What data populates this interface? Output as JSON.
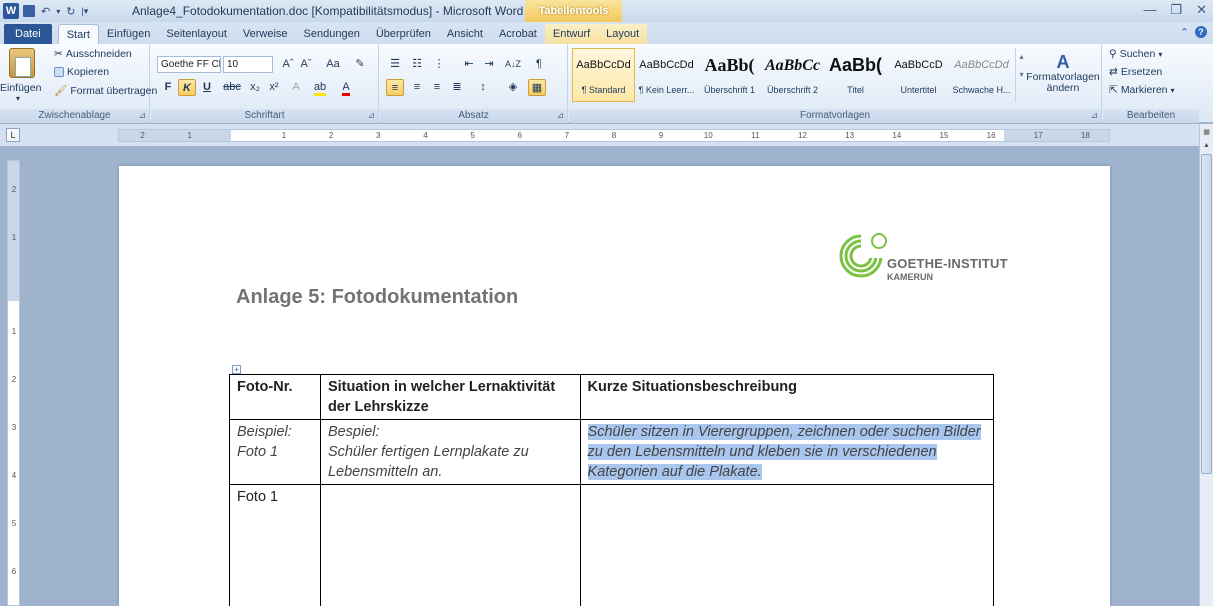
{
  "window": {
    "app_icon": "W",
    "title": "Anlage4_Fotodokumentation.doc [Kompatibilitätsmodus] - Microsoft Word",
    "contextual_tab_group": "Tabellentools"
  },
  "tabs": [
    "Datei",
    "Start",
    "Einfügen",
    "Seitenlayout",
    "Verweise",
    "Sendungen",
    "Überprüfen",
    "Ansicht",
    "Acrobat",
    "Entwurf",
    "Layout"
  ],
  "clipboard": {
    "paste": "Einfügen",
    "cut": "Ausschneiden",
    "copy": "Kopieren",
    "format_painter": "Format übertragen",
    "label": "Zwischenablage"
  },
  "font": {
    "name": "Goethe FF Cl",
    "size": "10",
    "grow": "Aˆ",
    "shrink": "Aˇ",
    "case": "Aa",
    "bold": "F",
    "italic": "K",
    "underline": "U",
    "strike": "abc",
    "subscript": "x₂",
    "superscript": "x²",
    "label": "Schriftart"
  },
  "paragraph": {
    "label": "Absatz",
    "pilcrow": "¶",
    "sort": "A↓Z"
  },
  "styles": {
    "label": "Formatvorlagen",
    "items": [
      {
        "sample": "AaBbCcDd",
        "name": "¶ Standard"
      },
      {
        "sample": "AaBbCcDd",
        "name": "¶ Kein Leerr..."
      },
      {
        "sample": "AaBb(",
        "name": "Überschrift 1"
      },
      {
        "sample": "AaBbCc",
        "name": "Überschrift 2"
      },
      {
        "sample": "AaBb(",
        "name": "Titel"
      },
      {
        "sample": "AaBbCcD",
        "name": "Untertitel"
      },
      {
        "sample": "AaBbCcDd",
        "name": "Schwache H..."
      }
    ],
    "change": "Formatvorlagen ändern"
  },
  "editing": {
    "find": "Suchen",
    "replace": "Ersetzen",
    "select": "Markieren",
    "label": "Bearbeiten"
  },
  "ruler": {
    "numbers": [
      "2",
      "1",
      "",
      "1",
      "2",
      "3",
      "4",
      "5",
      "6",
      "7",
      "8",
      "9",
      "10",
      "11",
      "12",
      "13",
      "14",
      "15",
      "16",
      "17",
      "18"
    ],
    "vertical": [
      "2",
      "1",
      "1",
      "2",
      "3",
      "4",
      "5",
      "6"
    ]
  },
  "document": {
    "logo_line1": "GOETHE-INSTITUT",
    "logo_line2": "KAMERUN",
    "title": "Anlage 5: Fotodokumentation",
    "table": {
      "headers": [
        "Foto-Nr.",
        "Situation in welcher Lernaktivität der Lehrskizze",
        "Kurze Situationsbeschreibung"
      ],
      "example": {
        "col1": "Beispiel:\nFoto 1",
        "col2": "Bespiel:\nSchüler fertigen Lernplakate zu Lebensmitteln an.",
        "col3": "Schüler sitzen in Vierergruppen, zeichnen oder suchen Bilder zu den Lebensmitteln und kleben sie in verschiedenen Kategorien auf die Plakate."
      },
      "row2": {
        "col1": "Foto 1",
        "col2": "",
        "col3": ""
      }
    }
  },
  "colors": {
    "accent": "#2b579a",
    "logo_green": "#7cc242",
    "selection": "#a8c6ee"
  }
}
